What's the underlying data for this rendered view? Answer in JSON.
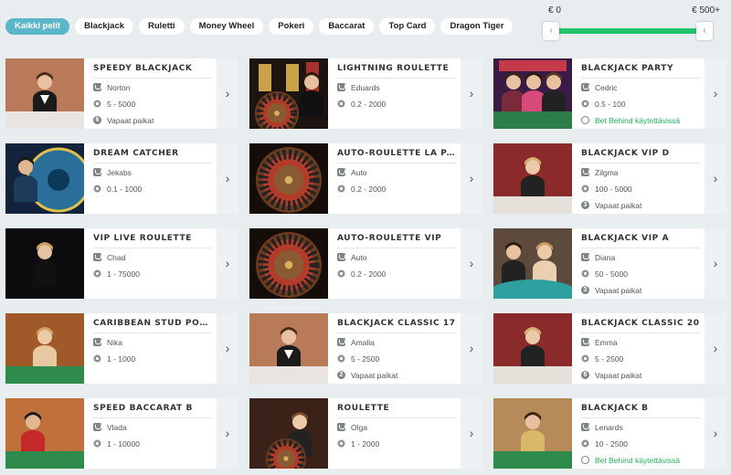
{
  "filters": [
    {
      "label": "Kaikki pelit",
      "active": true
    },
    {
      "label": "Blackjack",
      "active": false
    },
    {
      "label": "Ruletti",
      "active": false
    },
    {
      "label": "Money Wheel",
      "active": false
    },
    {
      "label": "Pokeri",
      "active": false
    },
    {
      "label": "Baccarat",
      "active": false
    },
    {
      "label": "Top Card",
      "active": false
    },
    {
      "label": "Dragon Tiger",
      "active": false
    }
  ],
  "stake_filter": {
    "min_label": "€ 0",
    "max_label": "€ 500+",
    "left_handle": "‹",
    "right_handle": "‹",
    "selected_min_fraction": 0,
    "selected_max_fraction": 1
  },
  "colors": {
    "accent": "#5ab6c8",
    "slider_fill": "#22c36b",
    "bet_behind": "#1fb35a"
  },
  "games": [
    {
      "title": "SPEEDY BLACKJACK",
      "dealer": "Norton",
      "limits": "5 - 5000",
      "status": "Vapaat paikat",
      "seats": "6",
      "status_type": "seats",
      "thumb": "blackjack-male"
    },
    {
      "title": "LIGHTNING ROULETTE",
      "dealer": "Eduards",
      "limits": "0.2 - 2000",
      "status": "",
      "status_type": "none",
      "thumb": "lightning"
    },
    {
      "title": "BLACKJACK PARTY",
      "dealer": "Cedric",
      "limits": "0.5 - 100",
      "status": "Bet Behind käytettävissä",
      "status_type": "betbehind",
      "thumb": "party"
    },
    {
      "title": "DREAM CATCHER",
      "dealer": "Jekabs",
      "limits": "0.1 - 1000",
      "status": "",
      "status_type": "none",
      "thumb": "wheel"
    },
    {
      "title": "AUTO-ROULETTE LA PARTAGE",
      "dealer": "Auto",
      "limits": "0.2 - 2000",
      "status": "",
      "status_type": "none",
      "thumb": "roulette"
    },
    {
      "title": "BLACKJACK VIP D",
      "dealer": "Zilgma",
      "limits": "100 - 5000",
      "status": "Vapaat paikat",
      "seats": "3",
      "status_type": "seats",
      "thumb": "blackjack-female"
    },
    {
      "title": "VIP LIVE ROULETTE",
      "dealer": "Chad",
      "limits": "1 - 75000",
      "status": "",
      "status_type": "none",
      "thumb": "vip-roulette"
    },
    {
      "title": "AUTO-ROULETTE VIP",
      "dealer": "Auto",
      "limits": "0.2 - 2000",
      "status": "",
      "status_type": "none",
      "thumb": "roulette"
    },
    {
      "title": "BLACKJACK VIP A",
      "dealer": "Diana",
      "limits": "50 - 5000",
      "status": "Vapaat paikat",
      "seats": "3",
      "status_type": "seats",
      "thumb": "blackjack-table"
    },
    {
      "title": "CARIBBEAN STUD POKER",
      "dealer": "Nika",
      "limits": "1 - 1000",
      "status": "",
      "status_type": "none",
      "thumb": "poker"
    },
    {
      "title": "BLACKJACK CLASSIC 17",
      "dealer": "Amalia",
      "limits": "5 - 2500",
      "status": "Vapaat paikat",
      "seats": "2",
      "status_type": "seats",
      "thumb": "blackjack-male"
    },
    {
      "title": "BLACKJACK CLASSIC 20",
      "dealer": "Emma",
      "limits": "5 - 2500",
      "status": "Vapaat paikat",
      "seats": "6",
      "status_type": "seats",
      "thumb": "blackjack-female"
    },
    {
      "title": "SPEED BACCARAT B",
      "dealer": "Vlada",
      "limits": "1 - 10000",
      "status": "",
      "status_type": "none",
      "thumb": "baccarat"
    },
    {
      "title": "ROULETTE",
      "dealer": "Olga",
      "limits": "1 - 2000",
      "status": "",
      "status_type": "none",
      "thumb": "roulette-dealer"
    },
    {
      "title": "BLACKJACK B",
      "dealer": "Lenards",
      "limits": "10 - 2500",
      "status": "Bet Behind käytettävissä",
      "status_type": "betbehind",
      "thumb": "blackjack-gold"
    }
  ]
}
